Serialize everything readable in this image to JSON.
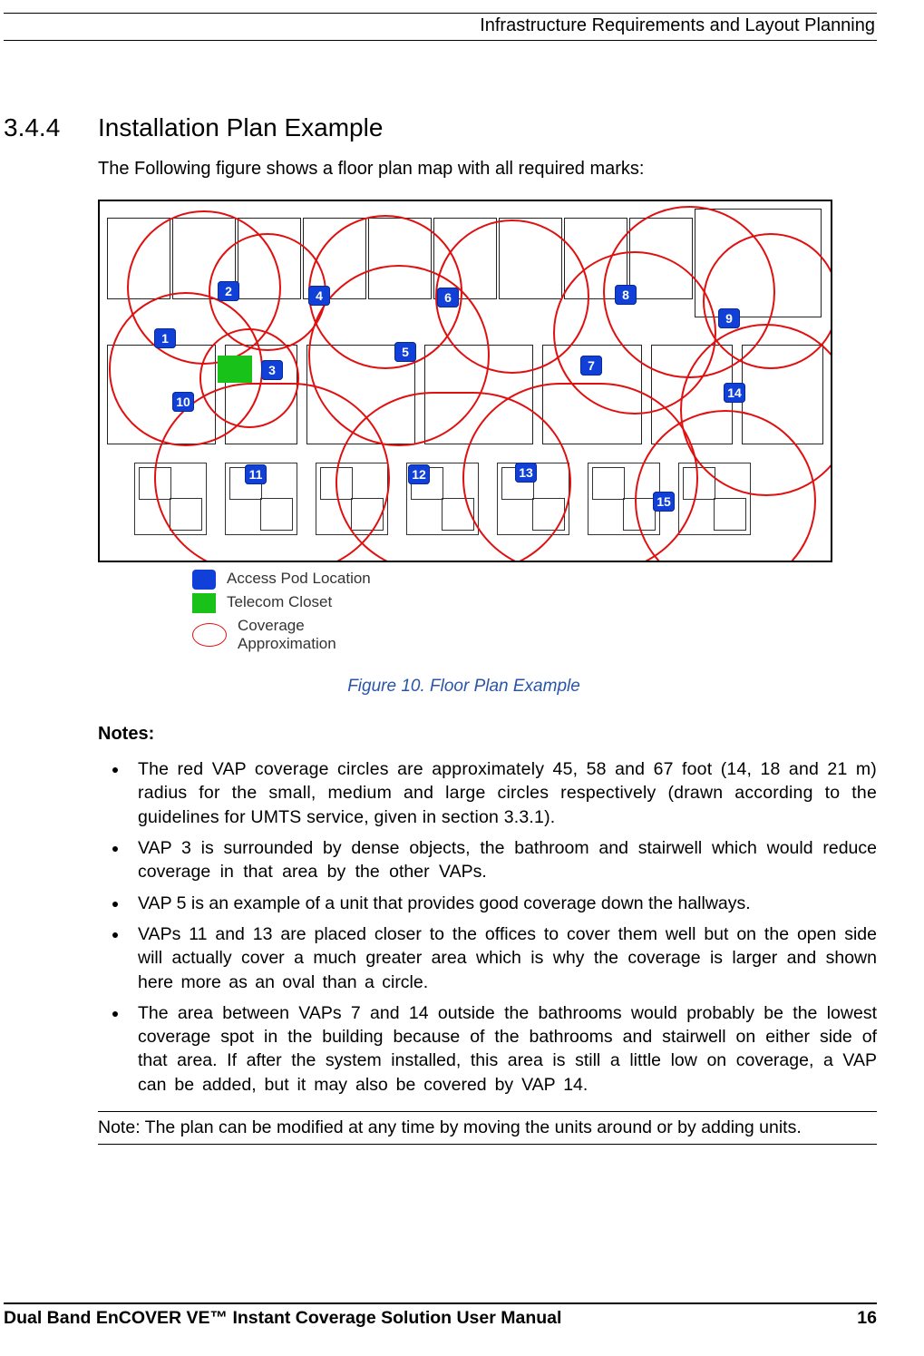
{
  "header": {
    "title": "Infrastructure Requirements and Layout Planning"
  },
  "section": {
    "number": "3.4.4",
    "title": "Installation Plan Example"
  },
  "intro": "The Following figure shows a floor plan map with all required marks:",
  "legend": {
    "access_pod": "Access Pod Location",
    "telecom_closet": "Telecom Closet",
    "coverage_line1": "Coverage",
    "coverage_line2": "Approximation"
  },
  "caption": "Figure 10. Floor Plan Example",
  "notes_heading": "Notes:",
  "notes": [
    "The red VAP coverage circles are approximately 45, 58 and 67 foot (14, 18 and 21 m) radius for the small, medium and large circles respectively (drawn according to the guidelines for UMTS service, given in section 3.3.1).",
    "VAP 3 is surrounded by dense objects, the bathroom and stairwell which would reduce coverage in that area by the other VAPs.",
    "VAP 5 is an example of a unit that provides good coverage down the hallways.",
    "VAPs 11 and 13 are placed closer to the offices to cover them well but on the open side will actually cover a much greater area which is why the coverage is larger and shown here more as an oval than a circle.",
    "The area between VAPs 7 and 14 outside the bathrooms would probably be the lowest coverage spot in the building because of the bathrooms and stairwell on either side of that area. If after the system installed, this area is still a little low on coverage, a VAP can be added, but it may also be covered by VAP 14."
  ],
  "final_note": "Note: The plan can be modified at any time by moving the units around or by adding units.",
  "footer": {
    "left": "Dual Band EnCOVER VE™ Instant Coverage Solution User Manual",
    "right": "16"
  },
  "access_pods": [
    "1",
    "2",
    "3",
    "4",
    "5",
    "6",
    "7",
    "8",
    "9",
    "10",
    "11",
    "12",
    "13",
    "14",
    "15"
  ]
}
